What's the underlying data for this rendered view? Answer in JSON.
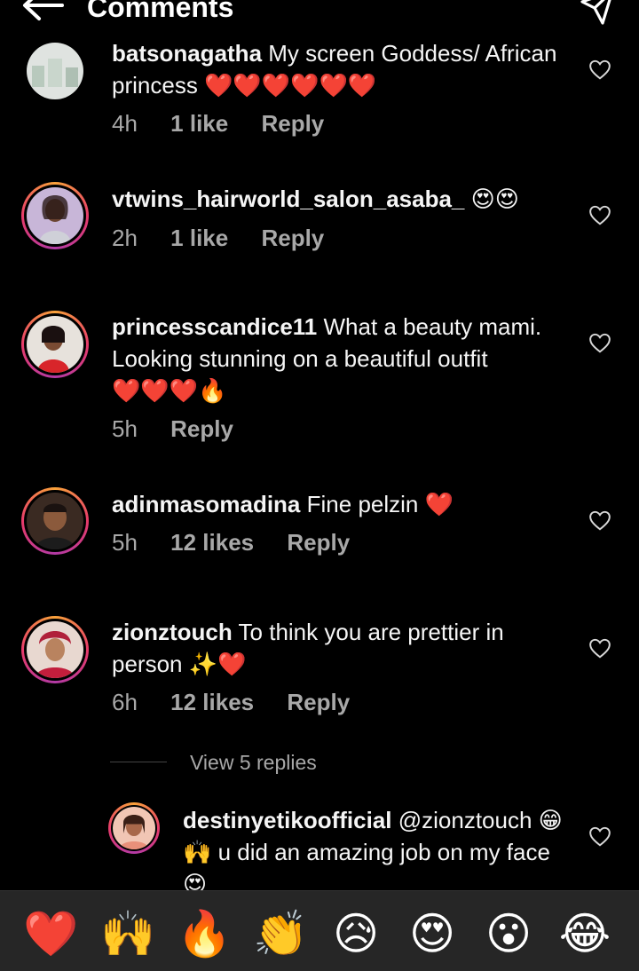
{
  "header": {
    "title": "Comments"
  },
  "comments": [
    {
      "username": "batsonagatha",
      "text": "My screen Goddess/ African princess",
      "emoji": "❤️❤️❤️❤️❤️❤️",
      "time": "4h",
      "likes": "1 like",
      "reply": "Reply"
    },
    {
      "username": "vtwins_hairworld_salon_asaba_",
      "text": "",
      "emoji": "😍😍",
      "time": "2h",
      "likes": "1 like",
      "reply": "Reply"
    },
    {
      "username": "princesscandice11",
      "text": "What a beauty mami. Looking stunning on a beautiful outfit",
      "emoji": "❤️❤️❤️🔥",
      "time": "5h",
      "likes": "",
      "reply": "Reply"
    },
    {
      "username": "adinmasomadina",
      "text": "Fine pelzin",
      "emoji": "❤️",
      "time": "5h",
      "likes": "12 likes",
      "reply": "Reply"
    },
    {
      "username": "zionztouch",
      "text": "To think you are prettier in person",
      "emoji": "✨❤️",
      "time": "6h",
      "likes": "12 likes",
      "reply": "Reply"
    }
  ],
  "view_replies": "View 5 replies",
  "reply": {
    "username": "destinyetikoofficial",
    "mention": "@zionztouch",
    "emoji": "😁🙌",
    "text": "u did an amazing job on my face",
    "trail_emoji": "😍"
  },
  "emoji_bar": [
    "❤️",
    "🙌",
    "🔥",
    "👏",
    "😥",
    "😍",
    "😮",
    "😂"
  ],
  "colors": {
    "background": "#000000",
    "meta": "#a8a8a8",
    "bar": "#262626",
    "ring_start": "#f9a23a",
    "ring_end": "#b23aa5"
  }
}
